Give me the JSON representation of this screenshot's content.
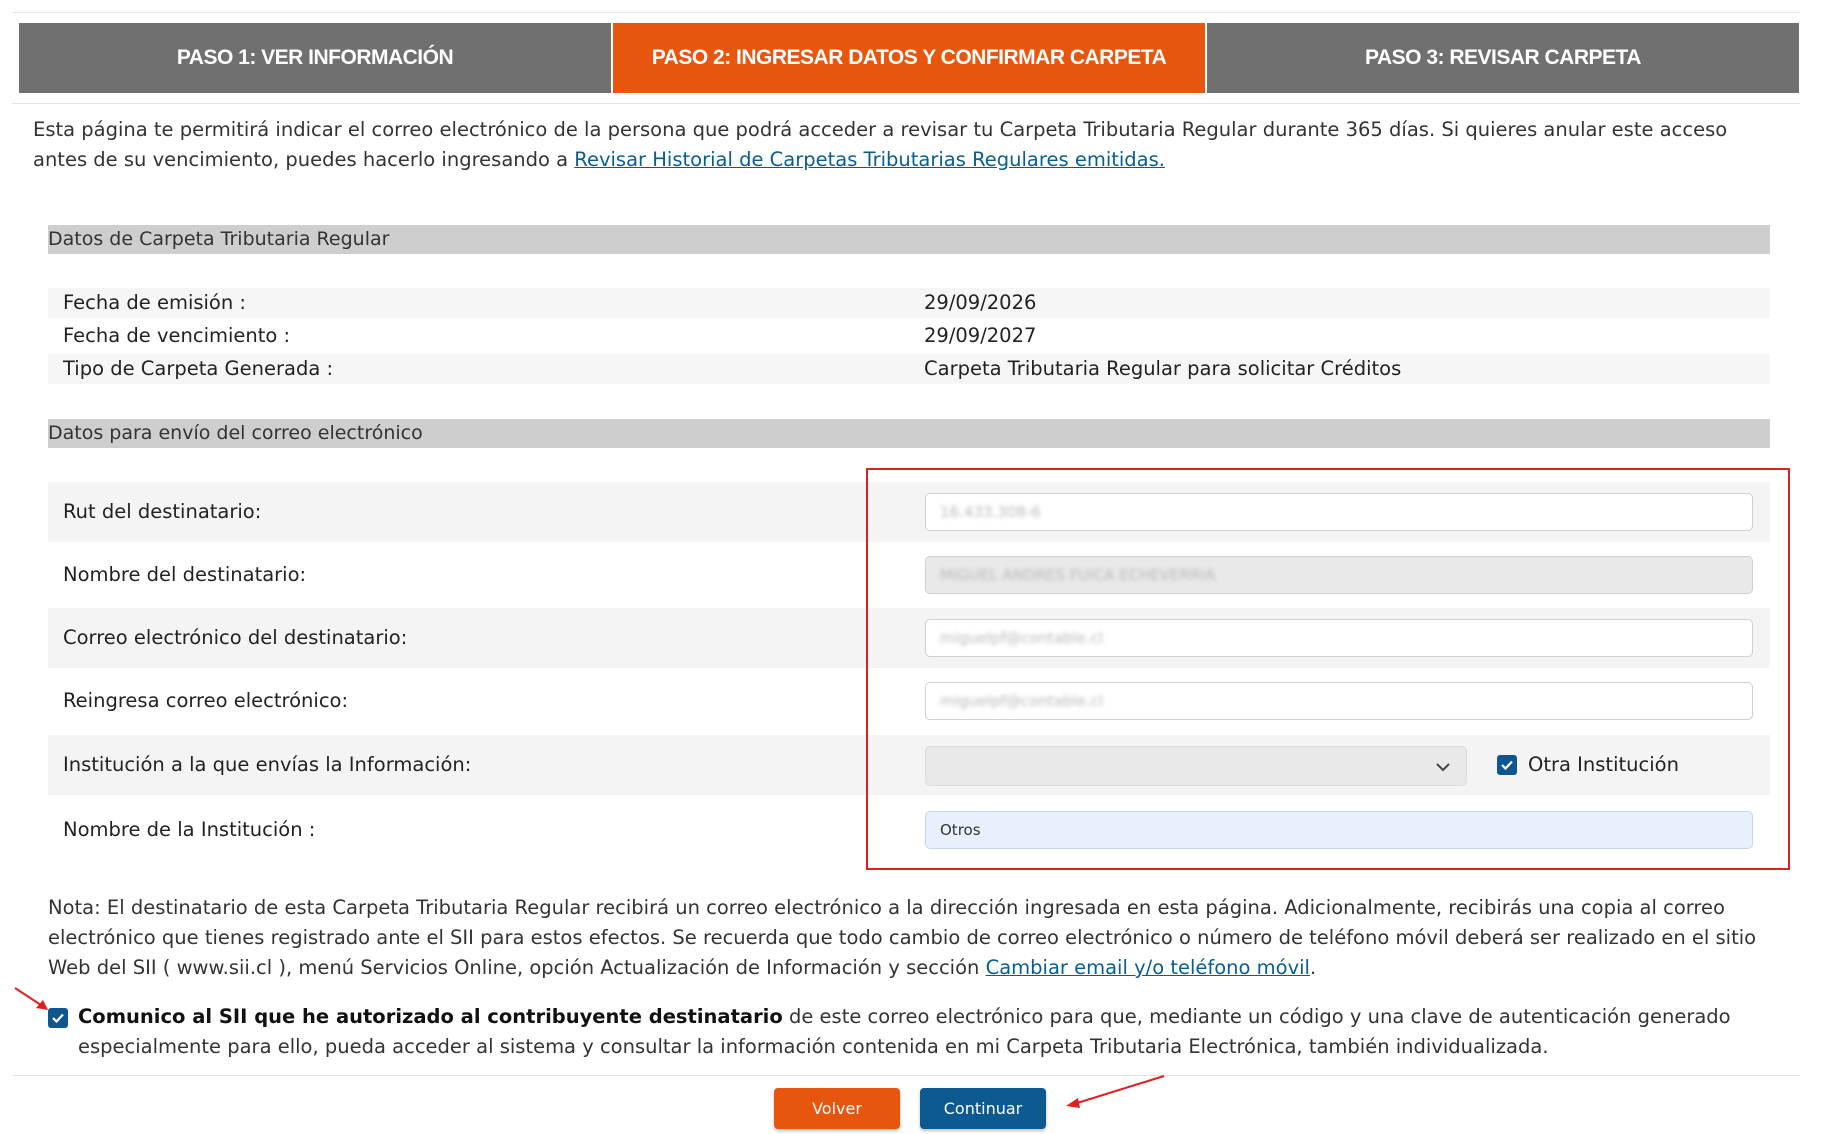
{
  "steps": {
    "step1": "PASO 1: VER INFORMACIÓN",
    "step2": "PASO 2: INGRESAR DATOS Y CONFIRMAR CARPETA",
    "step3": "PASO 3: REVISAR CARPETA",
    "active_color": "#e8560e",
    "inactive_color": "#707070"
  },
  "intro": {
    "text": "Esta página te permitirá indicar el correo electrónico de la persona que podrá acceder a revisar tu Carpeta Tributaria Regular durante 365 días. Si quieres anular este acceso antes de su vencimiento, puedes hacerlo ingresando a ",
    "link": "Revisar Historial de Carpetas Tributarias Regulares emitidas."
  },
  "carpeta": {
    "title": "Datos de Carpeta Tributaria Regular",
    "rows": [
      {
        "label": "Fecha de emisión :",
        "value": "29/09/2026"
      },
      {
        "label": "Fecha de vencimiento :",
        "value": "29/09/2027"
      },
      {
        "label": "Tipo de Carpeta Generada :",
        "value": "Carpeta Tributaria Regular para solicitar Créditos"
      }
    ]
  },
  "envio": {
    "title": "Datos para envío del correo electrónico",
    "rut_label": "Rut del destinatario:",
    "rut_value": "16.433.308-6",
    "nombre_label": "Nombre del destinatario:",
    "nombre_value": "MIGUEL ANDRES FUICA ECHEVERRIA",
    "correo_label": "Correo electrónico del destinatario:",
    "correo_value": "miguelpf@contable.cl",
    "reingresa_label": "Reingresa correo electrónico:",
    "reingresa_value": "miguelpf@contable.cl",
    "institucion_label": "Institución a la que envías la Información:",
    "otra_institucion_label": "Otra Institución",
    "otra_institucion_checked": true,
    "nombre_inst_label": "Nombre de la Institución :",
    "nombre_inst_value": "Otros"
  },
  "note": {
    "text": "Nota: El destinatario de esta Carpeta Tributaria Regular recibirá un correo electrónico a la dirección ingresada en esta página. Adicionalmente, recibirás una copia al correo electrónico que tienes registrado ante el SII para estos efectos. Se recuerda que todo cambio de correo electrónico o número de teléfono móvil deberá ser realizado en el sitio Web del SII ( www.sii.cl ), menú Servicios Online, opción Actualización de Información y sección ",
    "link": "Cambiar email y/o teléfono móvil",
    "end": "."
  },
  "consent": {
    "bold": "Comunico al SII que he autorizado al contribuyente destinatario",
    "rest": " de este correo electrónico para que, mediante un código y una clave de autenticación generado especialmente para ello, pueda acceder al sistema y consultar la información contenida en mi Carpeta Tributaria Electrónica, también individualizada.",
    "checked": true
  },
  "buttons": {
    "volver": "Volver",
    "continuar": "Continuar"
  }
}
